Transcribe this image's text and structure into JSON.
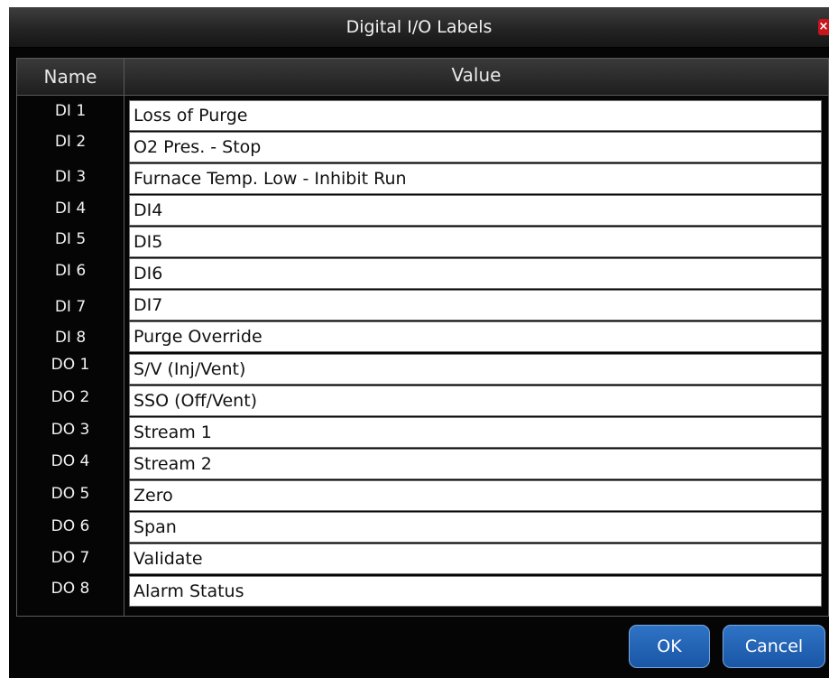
{
  "dialog": {
    "title": "Digital I/O Labels",
    "close_label": "×"
  },
  "table": {
    "headers": {
      "name": "Name",
      "value": "Value"
    },
    "rows": [
      {
        "name": "DI 1",
        "value": "Loss of Purge"
      },
      {
        "name": "DI 2",
        "value": "O2 Pres. - Stop"
      },
      {
        "name": "DI 3",
        "value": "Furnace Temp. Low - Inhibit Run"
      },
      {
        "name": "DI 4",
        "value": "DI4"
      },
      {
        "name": "DI 5",
        "value": "DI5"
      },
      {
        "name": "DI 6",
        "value": "DI6"
      },
      {
        "name": "DI 7",
        "value": "DI7"
      },
      {
        "name": "DI 8",
        "value": "Purge Override"
      },
      {
        "name": "DO 1",
        "value": "S/V (Inj/Vent)"
      },
      {
        "name": "DO 2",
        "value": "SSO (Off/Vent)"
      },
      {
        "name": "DO 3",
        "value": "Stream 1"
      },
      {
        "name": "DO 4",
        "value": "Stream 2"
      },
      {
        "name": "DO 5",
        "value": "Zero"
      },
      {
        "name": "DO 6",
        "value": "Span"
      },
      {
        "name": "DO 7",
        "value": "Validate"
      },
      {
        "name": "DO 8",
        "value": "Alarm Status"
      }
    ]
  },
  "buttons": {
    "ok": "OK",
    "cancel": "Cancel"
  },
  "colors": {
    "dialog_bg": "#050505",
    "button_blue": "#1f5fb0",
    "close_red": "#c8161c"
  }
}
